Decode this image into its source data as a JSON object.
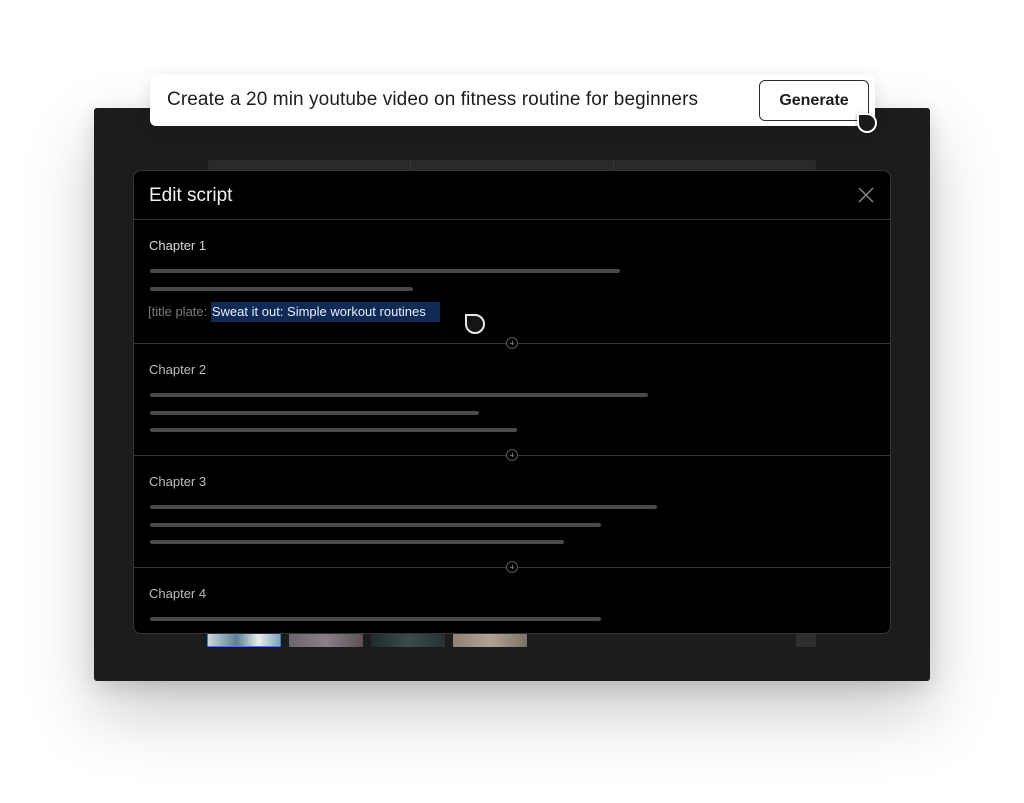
{
  "prompt": {
    "text": "Create a 20 min youtube video on fitness routine for beginners",
    "generate_label": "Generate"
  },
  "modal": {
    "title": "Edit script",
    "close_icon": "close-icon"
  },
  "chapters": [
    {
      "label": "Chapter 1",
      "title_plate": {
        "prefix": "[title plate: ",
        "selected_text": "Sweat it out: Simple workout routines"
      }
    },
    {
      "label": "Chapter 2"
    },
    {
      "label": "Chapter 3"
    },
    {
      "label": "Chapter 4"
    }
  ],
  "colors": {
    "modal_bg": "#000000",
    "selection_bg": "#0f2a54",
    "frame_bg": "#1c1c1c",
    "placeholder_line": "#4a4a4a"
  }
}
